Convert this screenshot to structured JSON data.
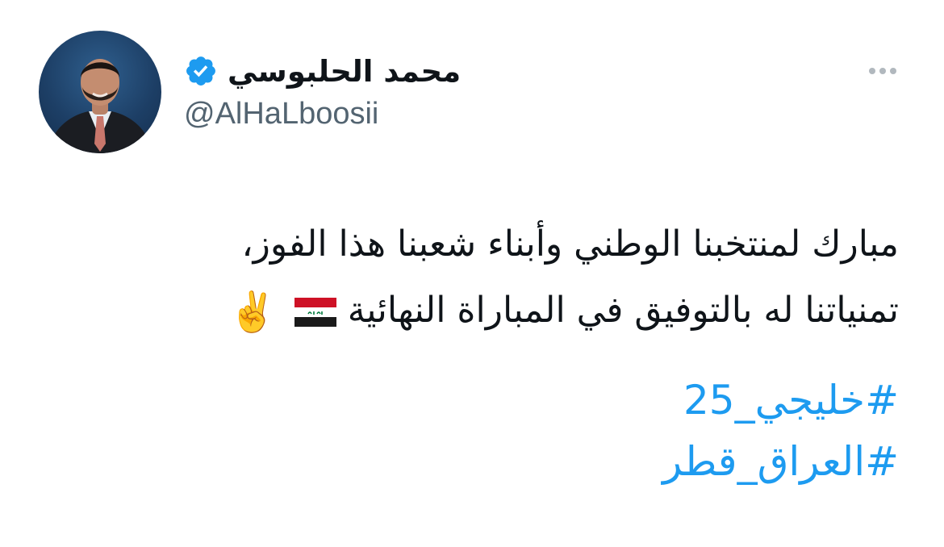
{
  "author": {
    "display_name": "محمد الحلبوسي",
    "handle": "@AlHaLboosii",
    "verified_icon": "verified-badge-icon",
    "avatar_icon": "profile-photo"
  },
  "more_button": {
    "icon": "more-horizontal-icon"
  },
  "tweet": {
    "line1": "مبارك لمنتخبنا الوطني وأبناء شعبنا هذا الفوز،",
    "line2": "تمنياتنا له بالتوفيق في المباراة النهائية",
    "flag_emoji": "iraq-flag-icon",
    "peace_emoji": "✌️"
  },
  "hashtags": [
    "#خليجي_25",
    "#العراق_قطر"
  ],
  "colors": {
    "link": "#1d9bf0",
    "text": "#0f1419",
    "secondary": "#536471",
    "verified": "#1d9bf0"
  }
}
